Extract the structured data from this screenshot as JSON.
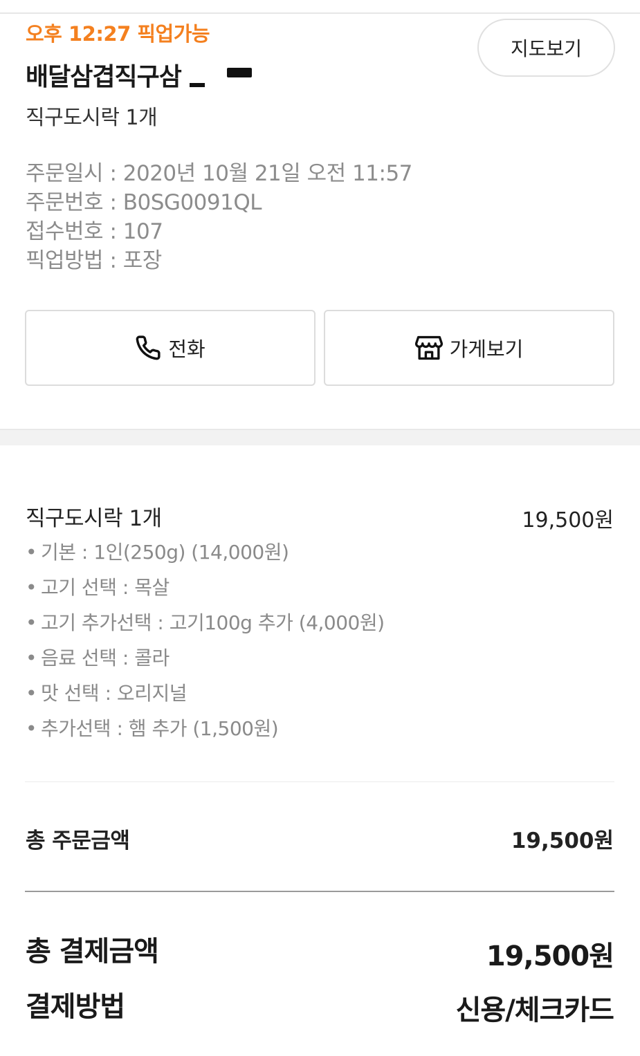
{
  "header": {
    "pickup_status": "오후 12:27 픽업가능",
    "store_name": "배달삼겹직구삼",
    "map_button_label": "지도보기",
    "order_summary": "직구도시락 1개"
  },
  "order_info": [
    {
      "label": "주문일시",
      "separator": " : ",
      "value": "2020년 10월 21일 오전 11:57"
    },
    {
      "label": "주문번호",
      "separator": " : ",
      "value": "B0SG0091QL"
    },
    {
      "label": "접수번호",
      "separator": " : ",
      "value": "107"
    },
    {
      "label": "픽업방법",
      "separator": " : ",
      "value": "포장"
    }
  ],
  "actions": {
    "call_label": "전화",
    "call_icon": "phone-icon",
    "store_label": "가게보기",
    "store_icon": "store-icon"
  },
  "item": {
    "title": "직구도시락 1개",
    "price": "19,500원",
    "bullet": "•",
    "options": [
      "기본 : 1인(250g) (14,000원)",
      "고기 선택 : 목살",
      "고기 추가선택 : 고기100g 추가 (4,000원)",
      "음료 선택 : 콜라",
      "맛 선택 : 오리지널",
      "추가선택 : 햄 추가 (1,500원)"
    ]
  },
  "totals": {
    "order_total_label": "총 주문금액",
    "order_total_value": "19,500원",
    "payment_total_label": "총 결제금액",
    "payment_total_value": "19,500원",
    "payment_method_label": "결제방법",
    "payment_method_value": "신용/체크카드"
  },
  "colors": {
    "accent": "#f4801f",
    "muted_text": "#8c8c8c",
    "border": "#dcdcdc"
  }
}
